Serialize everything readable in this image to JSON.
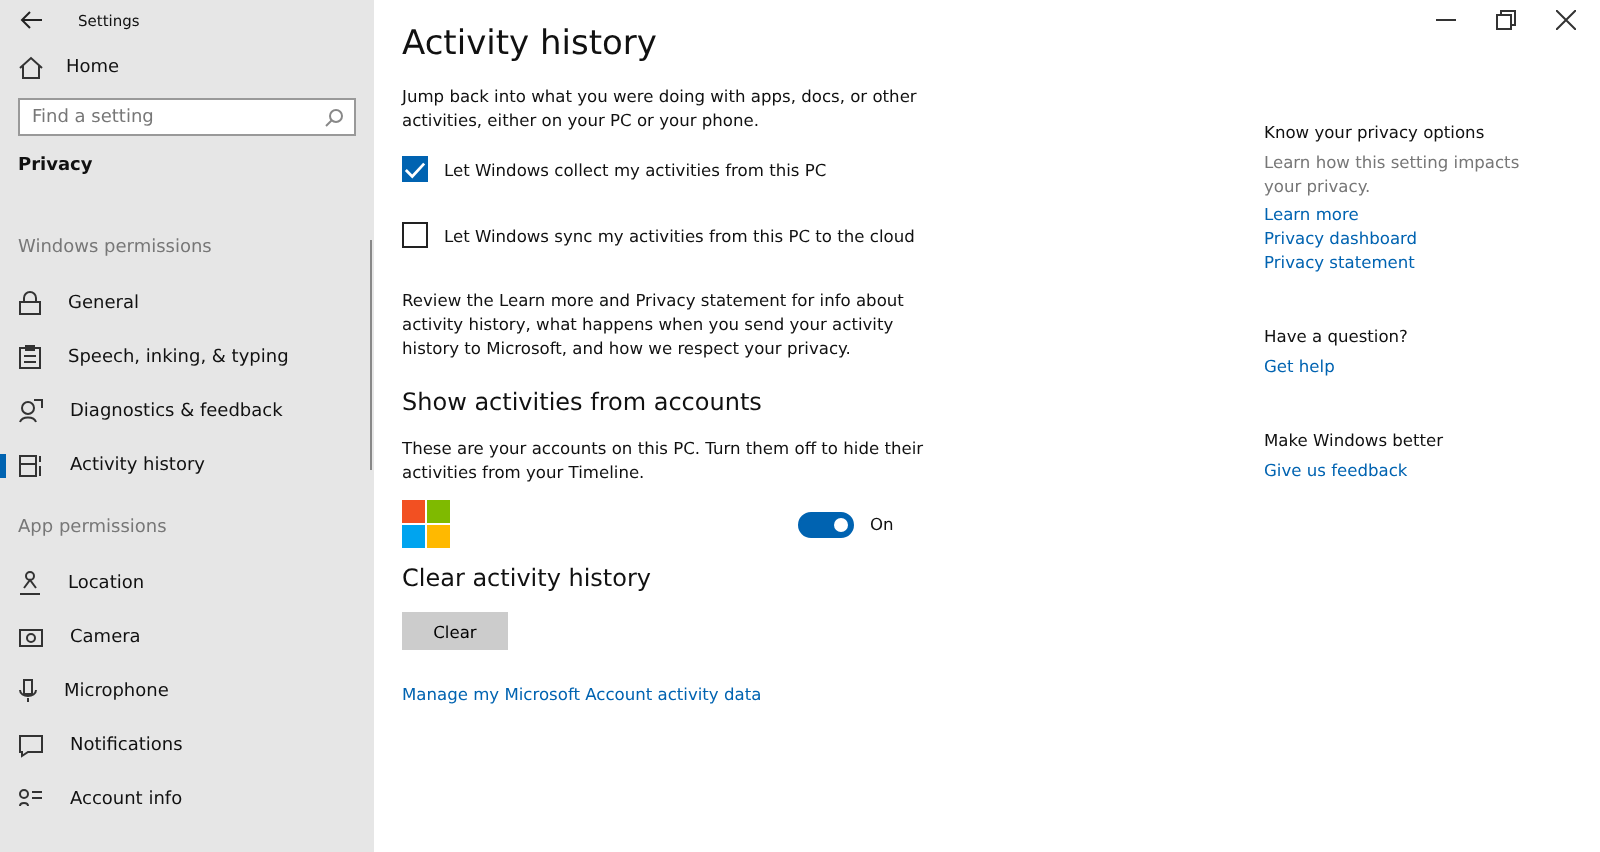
{
  "window": {
    "title": "Settings"
  },
  "sidebar": {
    "home": "Home",
    "search": {
      "placeholder": "Find a setting"
    },
    "section": "Privacy",
    "groups": [
      {
        "heading": "Windows permissions",
        "items": [
          {
            "label": "General",
            "kind": "lock",
            "selected": false
          },
          {
            "label": "Speech, inking, & typing",
            "kind": "clipboard",
            "selected": false
          },
          {
            "label": "Diagnostics & feedback",
            "kind": "people",
            "selected": false
          },
          {
            "label": "Activity history",
            "kind": "timeline",
            "selected": true
          }
        ]
      },
      {
        "heading": "App permissions",
        "items": [
          {
            "label": "Location",
            "kind": "pin",
            "selected": false
          },
          {
            "label": "Camera",
            "kind": "camera",
            "selected": false
          },
          {
            "label": "Microphone",
            "kind": "mic",
            "selected": false
          },
          {
            "label": "Notifications",
            "kind": "chat",
            "selected": false
          },
          {
            "label": "Account info",
            "kind": "person",
            "selected": false
          }
        ]
      }
    ]
  },
  "main": {
    "title": "Activity history",
    "intro": "Jump back into what you were doing with apps, docs, or other activities, either on your PC or your phone.",
    "checkboxes": [
      {
        "label": "Let Windows collect my activities from this PC",
        "checked": true
      },
      {
        "label": "Let Windows sync my activities from this PC to the cloud",
        "checked": false
      }
    ],
    "review": "Review the Learn more and Privacy statement for info about activity history, what happens when you send your activity history to Microsoft, and how we respect your privacy.",
    "accounts": {
      "heading": "Show activities from accounts",
      "description": "These are your accounts on this PC. Turn them off to hide their activities from your Timeline.",
      "toggle": {
        "on": true,
        "label": "On"
      }
    },
    "clear": {
      "heading": "Clear activity history",
      "button": "Clear"
    },
    "link": "Manage my Microsoft Account activity data"
  },
  "aside": [
    {
      "heading": "Know your privacy options",
      "text": "Learn how this setting impacts your privacy.",
      "links": [
        "Learn more",
        "Privacy dashboard",
        "Privacy statement"
      ]
    },
    {
      "heading": "Have a question?",
      "links": [
        "Get help"
      ]
    },
    {
      "heading": "Make Windows better",
      "links": [
        "Give us feedback"
      ]
    }
  ]
}
